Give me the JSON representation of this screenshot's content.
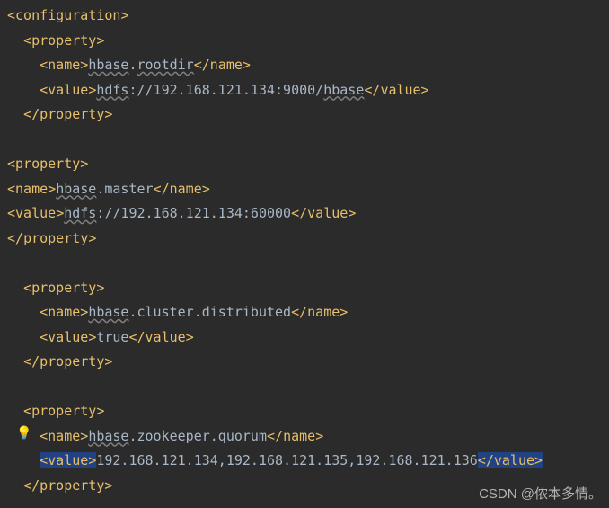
{
  "lines": {
    "l1": {
      "a": "<",
      "b": "configuration",
      "c": ">"
    },
    "l2": {
      "a": "<",
      "b": "property",
      "c": ">"
    },
    "l3": {
      "a": "<",
      "b": "name",
      "c": ">",
      "d": "hbase",
      "e": ".",
      "f": "rootdir",
      "g": "</",
      "h": "name",
      "i": ">"
    },
    "l4": {
      "a": "<",
      "b": "value",
      "c": ">",
      "d": "hdfs",
      "e": "://192.168.121.134:9000/",
      "f": "hbase",
      "g": "</",
      "h": "value",
      "i": ">"
    },
    "l5": {
      "a": "</",
      "b": "property",
      "c": ">"
    },
    "l6": {
      "a": "<",
      "b": "property",
      "c": ">"
    },
    "l7": {
      "a": "<",
      "b": "name",
      "c": ">",
      "d": "hbase",
      "e": ".master",
      "f": "</",
      "g": "name",
      "h": ">"
    },
    "l8": {
      "a": "<",
      "b": "value",
      "c": ">",
      "d": "hdfs",
      "e": "://192.168.121.134:60000",
      "f": "</",
      "g": "value",
      "h": ">"
    },
    "l9": {
      "a": "</",
      "b": "property",
      "c": ">"
    },
    "l10": {
      "a": "<",
      "b": "property",
      "c": ">"
    },
    "l11": {
      "a": "<",
      "b": "name",
      "c": ">",
      "d": "hbase",
      "e": ".cluster.distributed",
      "f": "</",
      "g": "name",
      "h": ">"
    },
    "l12": {
      "a": "<",
      "b": "value",
      "c": ">",
      "d": "true",
      "e": "</",
      "f": "value",
      "g": ">"
    },
    "l13": {
      "a": "</",
      "b": "property",
      "c": ">"
    },
    "l14": {
      "a": "<",
      "b": "property",
      "c": ">"
    },
    "l15": {
      "a": "<",
      "b": "name",
      "c": ">",
      "d": "hbase",
      "e": ".zookeeper.quorum",
      "f": "</",
      "g": "name",
      "h": ">"
    },
    "l16": {
      "a": "<",
      "b": "value",
      "c": ">",
      "d": "192.168.121.134,192.168.121.135,192.168.121.136",
      "e": "</",
      "f": "value",
      "g": ">"
    },
    "l17": {
      "a": "</",
      "b": "property",
      "c": ">"
    }
  },
  "watermark": "CSDN @侬本多情。"
}
